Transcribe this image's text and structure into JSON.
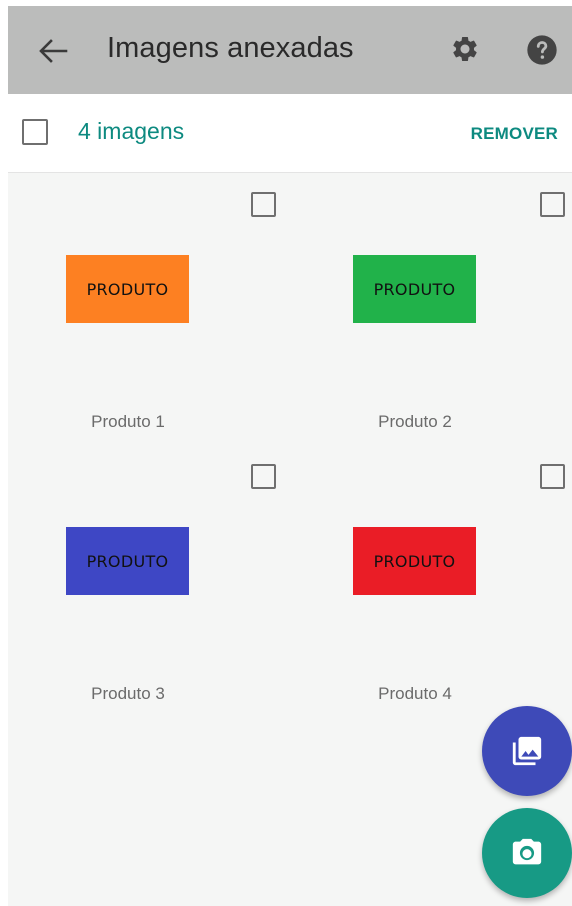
{
  "appbar": {
    "title": "Imagens anexadas",
    "background": "#bbbcbb",
    "icons": [
      "arrow-back-icon",
      "gear-icon",
      "help-icon"
    ]
  },
  "selection": {
    "count_label": "4 imagens",
    "remove_label": "REMOVER",
    "accent": "#0d8a80"
  },
  "images": [
    {
      "thumb_text": "PRODUTO",
      "caption": "Produto 1",
      "color": "#fd8022",
      "checked": false
    },
    {
      "thumb_text": "PRODUTO",
      "caption": "Produto 2",
      "color": "#21b24a",
      "checked": false
    },
    {
      "thumb_text": "PRODUTO",
      "caption": "Produto 3",
      "color": "#3e47c5",
      "checked": false
    },
    {
      "thumb_text": "PRODUTO",
      "caption": "Produto 4",
      "color": "#ea1d26",
      "checked": false
    }
  ],
  "fabs": {
    "gallery": {
      "icon": "photo-library-icon",
      "color": "#3e4ab8"
    },
    "camera": {
      "icon": "camera-icon",
      "color": "#179a85"
    }
  }
}
